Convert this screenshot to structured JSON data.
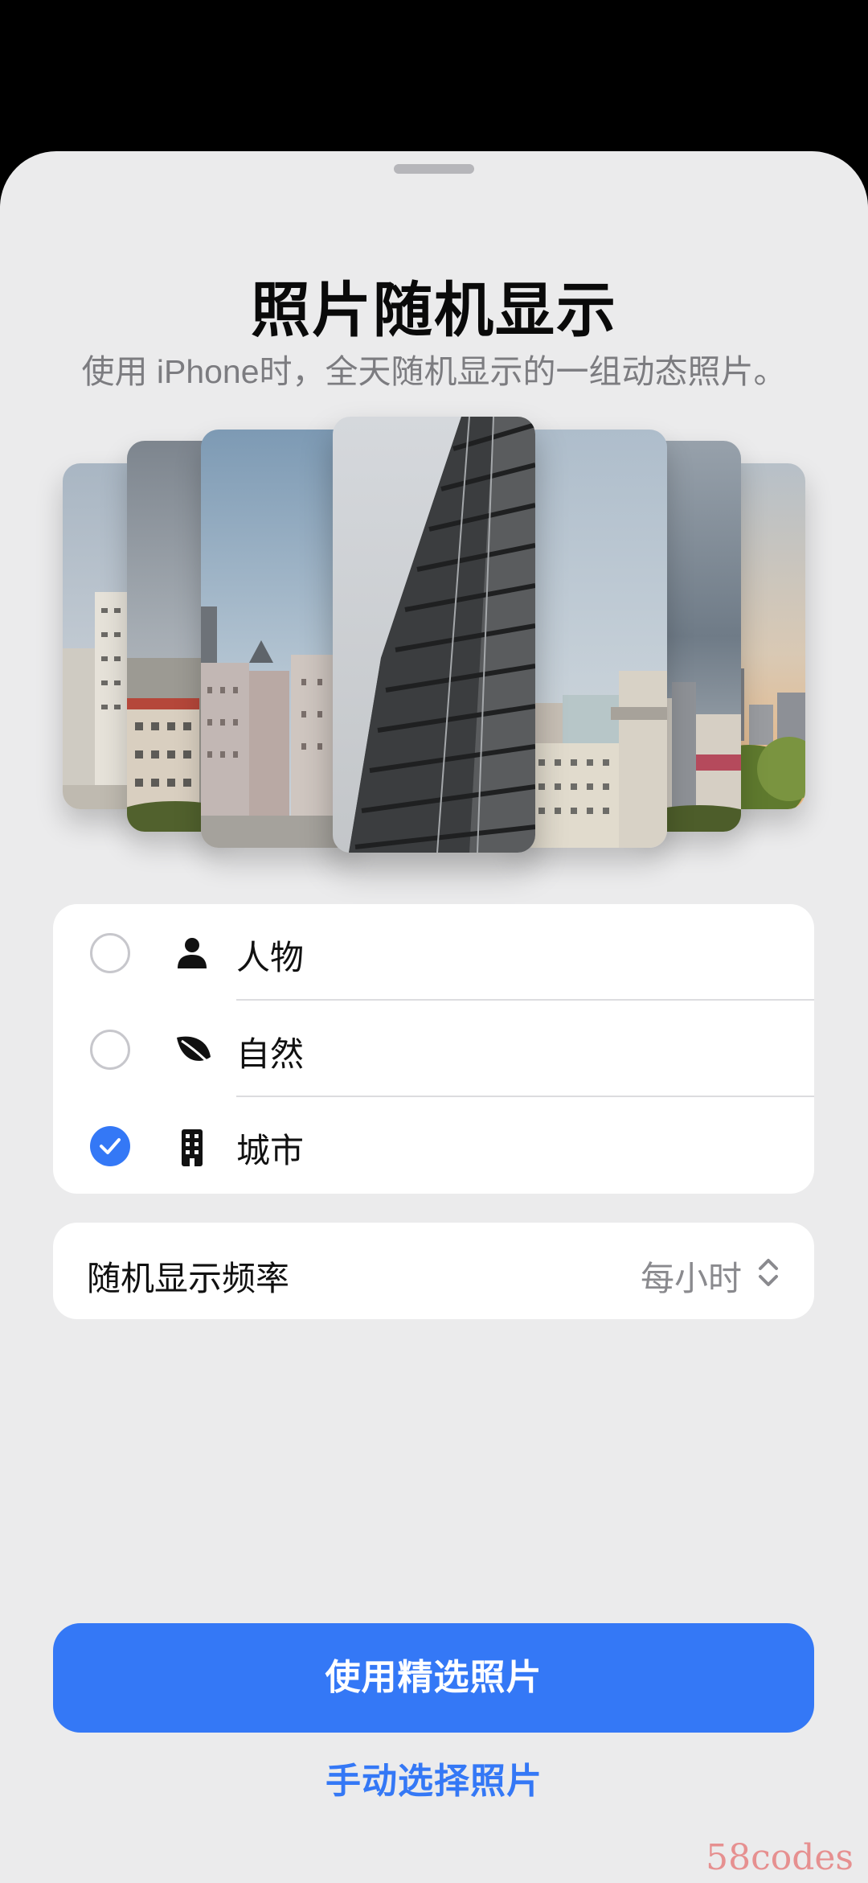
{
  "sheet": {
    "title": "照片随机显示",
    "subtitle": "使用 iPhone时，全天随机显示的一组动态照片。"
  },
  "preview_cards": [
    "city-photo-1",
    "city-photo-2",
    "city-photo-3",
    "city-photo-center",
    "city-photo-5",
    "city-photo-6",
    "city-photo-7"
  ],
  "categories": [
    {
      "label": "人物",
      "icon": "person-icon",
      "selected": false
    },
    {
      "label": "自然",
      "icon": "leaf-icon",
      "selected": false
    },
    {
      "label": "城市",
      "icon": "building-icon",
      "selected": true
    }
  ],
  "frequency": {
    "label": "随机显示频率",
    "value": "每小时",
    "icon": "chevron-up-down-icon"
  },
  "actions": {
    "primary_label": "使用精选照片",
    "secondary_label": "手动选择照片"
  },
  "watermark": "58codes",
  "colors": {
    "accent": "#3478f6",
    "sheet_background": "#ebebec",
    "group_background": "#ffffff"
  }
}
